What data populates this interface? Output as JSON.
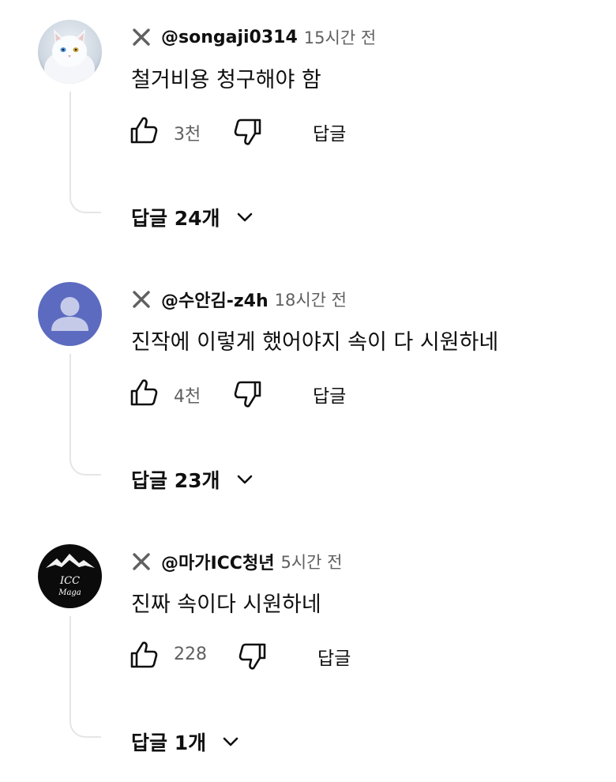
{
  "comments": [
    {
      "author": "@songaji0314",
      "time": "15시간 전",
      "text": "철거비용 청구해야 함",
      "likes": "3천",
      "reply_label": "답글",
      "replies_label": "답글 24개",
      "avatar": "white-cat-photo"
    },
    {
      "author": "@수안김-z4h",
      "time": "18시간 전",
      "text": "진작에 이렇게 했어야지 속이 다 시원하네",
      "likes": "4천",
      "reply_label": "답글",
      "replies_label": "답글 23개",
      "avatar": "default-person",
      "avatar_color": "#5c6bc0"
    },
    {
      "author": "@마가ICC청년",
      "time": "5시간 전",
      "text": "진짜 속이다 시원하네",
      "likes": "228",
      "reply_label": "답글",
      "replies_label": "답글 1개",
      "avatar": "icc-maga-logo",
      "avatar_logo_text": [
        "ICC",
        "Maga"
      ]
    }
  ]
}
